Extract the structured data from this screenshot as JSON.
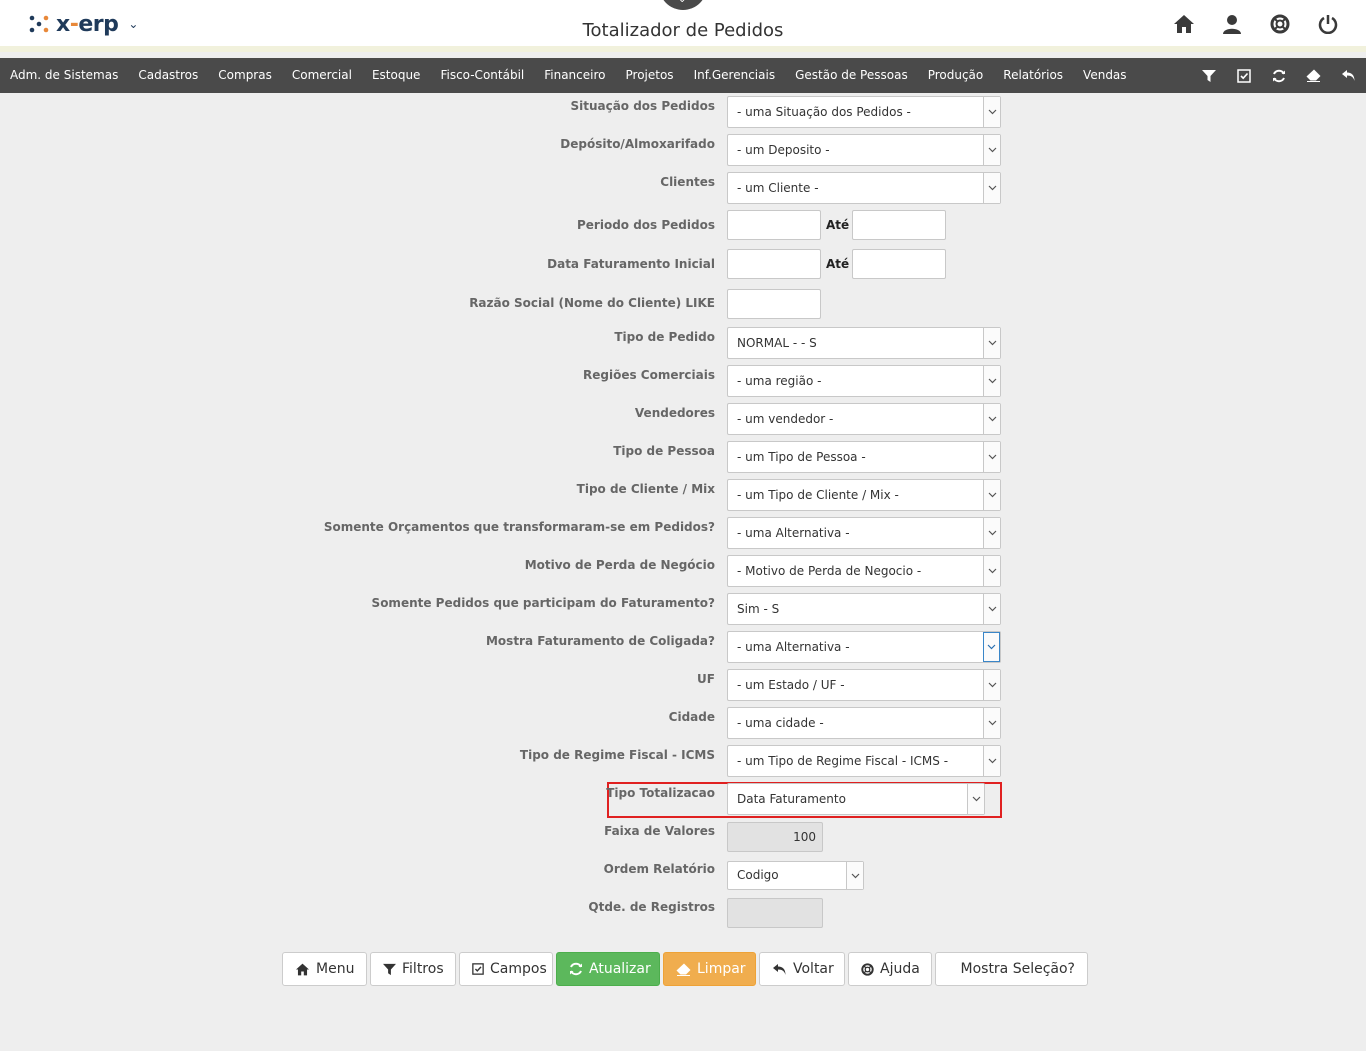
{
  "app": {
    "logo_text": "x-erp",
    "logo_dash": "-",
    "title": "Totalizador de Pedidos"
  },
  "top_icons": [
    "home-icon",
    "user-icon",
    "lifebuoy-icon",
    "power-icon"
  ],
  "menu": {
    "items": [
      "Adm. de Sistemas",
      "Cadastros",
      "Compras",
      "Comercial",
      "Estoque",
      "Fisco-Contábil",
      "Financeiro",
      "Projetos",
      "Inf.Gerenciais",
      "Gestão de Pessoas",
      "Produção",
      "Relatórios",
      "Vendas"
    ],
    "tools": [
      "filter-icon",
      "check-square-icon",
      "refresh-icon",
      "eraser-icon",
      "undo-icon"
    ]
  },
  "form": {
    "situacao": {
      "label": "Situação dos Pedidos",
      "value": "- uma Situação dos Pedidos -"
    },
    "deposito": {
      "label": "Depósito/Almoxarifado",
      "value": "- um Deposito -"
    },
    "clientes": {
      "label": "Clientes",
      "value": "- um Cliente -"
    },
    "periodo": {
      "label": "Periodo dos Pedidos",
      "ate": "Até"
    },
    "data_fat": {
      "label": "Data Faturamento Inicial",
      "ate": "Até"
    },
    "razao": {
      "label": "Razão Social (Nome do Cliente) LIKE"
    },
    "tipo_pedido": {
      "label": "Tipo de Pedido",
      "value": "NORMAL - - S"
    },
    "regioes": {
      "label": "Regiões Comerciais",
      "value": "- uma região -"
    },
    "vendedores": {
      "label": "Vendedores",
      "value": "- um vendedor -"
    },
    "tipo_pessoa": {
      "label": "Tipo de Pessoa",
      "value": "- um Tipo de Pessoa -"
    },
    "tipo_cliente": {
      "label": "Tipo de Cliente / Mix",
      "value": "- um Tipo de Cliente / Mix -"
    },
    "orcamentos": {
      "label": "Somente Orçamentos que transformaram-se em Pedidos?",
      "value": "- uma Alternativa -"
    },
    "motivo_perda": {
      "label": "Motivo de Perda de Negócio",
      "value": "- Motivo de Perda de Negocio -"
    },
    "somente_fat": {
      "label": "Somente Pedidos que participam do Faturamento?",
      "value": "Sim - S"
    },
    "coligada": {
      "label": "Mostra Faturamento de Coligada?",
      "value": "- uma Alternativa -"
    },
    "uf": {
      "label": "UF",
      "value": "- um Estado / UF -"
    },
    "cidade": {
      "label": "Cidade",
      "value": "- uma cidade -"
    },
    "regime": {
      "label": "Tipo de Regime Fiscal - ICMS",
      "value": "- um Tipo de Regime Fiscal - ICMS -"
    },
    "tipo_total": {
      "label": "Tipo Totalizacao",
      "value": "Data Faturamento"
    },
    "faixa": {
      "label": "Faixa de Valores",
      "value": "100"
    },
    "ordem": {
      "label": "Ordem Relatório",
      "value": "Codigo"
    },
    "qtde": {
      "label": "Qtde. de Registros",
      "value": ""
    }
  },
  "buttons": {
    "menu": "Menu",
    "filtros": "Filtros",
    "campos": "Campos",
    "atualizar": "Atualizar",
    "limpar": "Limpar",
    "voltar": "Voltar",
    "ajuda": "Ajuda",
    "mostra": "Mostra Seleção?"
  },
  "colors": {
    "menubar": "#4a4a4a",
    "green": "#5cb85c",
    "orange": "#f0ad4e",
    "highlight": "#e02020"
  }
}
